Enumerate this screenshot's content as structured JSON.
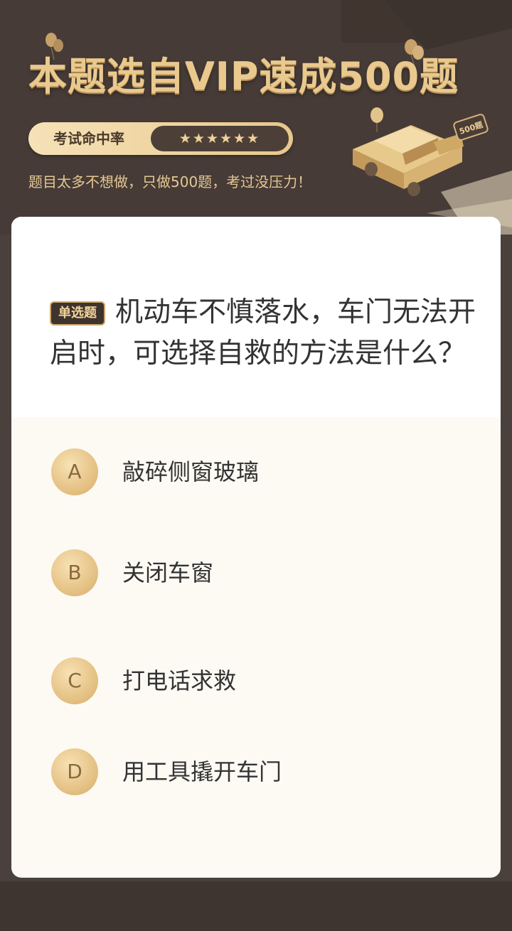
{
  "banner": {
    "title": "本题选自VIP速成500题",
    "rate_label": "考试命中率",
    "rate_stars": "★★★★★★",
    "subtitle": "题目太多不想做，只做500题，考过没压力！",
    "car_badge": "500题"
  },
  "question": {
    "type_tag": "单选题",
    "text": "机动车不慎落水，车门无法开启时，可选择自救的方法是什么？"
  },
  "options": [
    {
      "letter": "A",
      "text": "敲碎侧窗玻璃"
    },
    {
      "letter": "B",
      "text": "关闭车窗"
    },
    {
      "letter": "C",
      "text": "打电话求救"
    },
    {
      "letter": "D",
      "text": "用工具撬开车门"
    }
  ],
  "colors": {
    "background": "#4a403c",
    "gold": "#e9c98e",
    "card": "#fdfaf4",
    "text": "#333333"
  }
}
